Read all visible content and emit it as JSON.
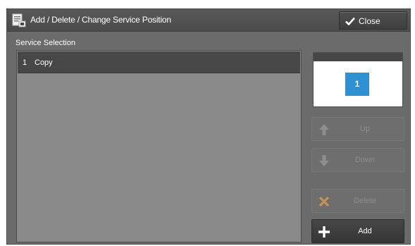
{
  "window": {
    "title": "Add / Delete / Change Service Position",
    "close_label": "Close"
  },
  "service_selection": {
    "label": "Service Selection",
    "items": [
      {
        "number": "1",
        "name": "Copy",
        "selected": true
      }
    ]
  },
  "preview": {
    "tile_label": "1",
    "tile_color": "#2e90d1"
  },
  "buttons": {
    "up": {
      "label": "Up",
      "enabled": false
    },
    "down": {
      "label": "Down",
      "enabled": false
    },
    "delete": {
      "label": "Delete",
      "enabled": false
    },
    "add": {
      "label": "Add",
      "enabled": true
    }
  },
  "icons": {
    "title": "service-list-icon",
    "close": "check-icon",
    "up": "arrow-up-icon",
    "down": "arrow-down-icon",
    "delete": "x-icon",
    "add": "plus-icon"
  },
  "colors": {
    "accent_blue": "#2e90d1",
    "delete_icon": "#c6905a"
  }
}
